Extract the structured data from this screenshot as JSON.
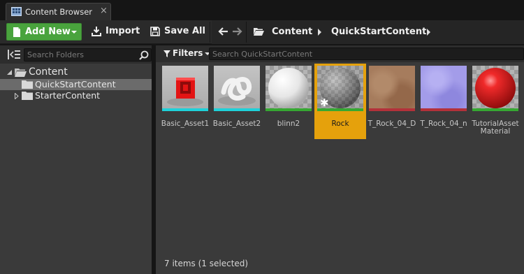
{
  "window": {
    "tab_title": "Content Browser",
    "tab_icon": "content-browser-icon",
    "close_glyph": "×"
  },
  "toolbar": {
    "add_new_label": "Add New",
    "import_label": "Import",
    "save_all_label": "Save All",
    "add_color": "#49a33d"
  },
  "path": {
    "crumbs": [
      "Content",
      "QuickStartContent"
    ]
  },
  "sources": {
    "search_placeholder": "Search Folders",
    "tree": [
      {
        "label": "Content",
        "expanded": true
      },
      {
        "label": "QuickStartContent",
        "selected": true
      },
      {
        "label": "StarterContent",
        "expanded": false
      }
    ]
  },
  "assets": {
    "filters_label": "Filters",
    "search_placeholder": "Search QuickStartContent",
    "items": [
      {
        "label": "Basic_Asset1",
        "stripe": "#1fd1d9"
      },
      {
        "label": "Basic_Asset2",
        "stripe": "#1fd1d9"
      },
      {
        "label": "blinn2",
        "stripe": "#36a832"
      },
      {
        "label": "Rock",
        "stripe": "#36a832",
        "selected": true
      },
      {
        "label": "T_Rock_04_D",
        "stripe": "#b3313a"
      },
      {
        "label": "T_Rock_04_n",
        "stripe": "#b3313a"
      },
      {
        "label": "TutorialAsset Material",
        "stripe": "#36a832"
      }
    ],
    "status": "7 items (1 selected)",
    "selection_color": "#e5a10c"
  }
}
